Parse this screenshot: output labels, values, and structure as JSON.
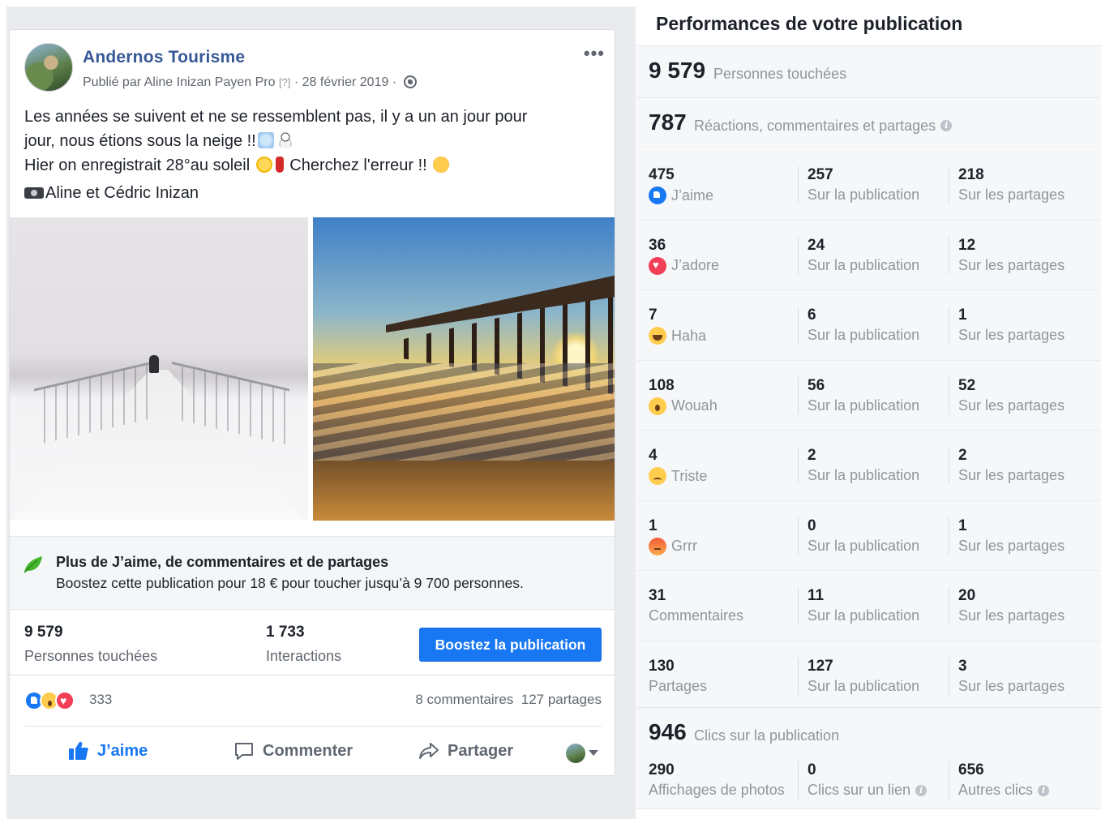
{
  "post": {
    "page_name": "Andernos Tourisme",
    "published_by": "Publié par Aline Inizan Payen Pro",
    "help_marker": "[?]",
    "date": "· 28 février 2019 ·",
    "more_label": "•••",
    "text_line1": "Les années se suivent et ne se ressemblent pas, il y a un an jour pour",
    "text_line2": "jour, nous étions sous la neige !!",
    "text_line3a": "Hier on enregistrait 28°au soleil",
    "text_line3b": "Cherchez l'erreur !!",
    "credit": "Aline et Cédric Inizan"
  },
  "promo": {
    "title": "Plus de J’aime, de commentaires et de partages",
    "subtitle": "Boostez cette publication pour 18 € pour toucher jusqu’à 9 700 personnes."
  },
  "stats": {
    "reach_num": "9 579",
    "reach_label": "Personnes touchées",
    "interactions_num": "1 733",
    "interactions_label": "Interactions",
    "boost_button": "Boostez la publication"
  },
  "reactions_bar": {
    "count": "333",
    "comments": "8 commentaires",
    "shares": "127 partages"
  },
  "actions": {
    "like": "J’aime",
    "comment": "Commenter",
    "share": "Partager"
  },
  "perf": {
    "title": "Performances de votre publication",
    "reach_num": "9 579",
    "reach_label": "Personnes touchées",
    "engagement_num": "787",
    "engagement_label": "Réactions, commentaires et partages",
    "rows": [
      {
        "total": "475",
        "label": "J’aime",
        "icon": "like-reaction-icon",
        "post": "257",
        "post_label": "Sur la publication",
        "shares": "218",
        "shares_label": "Sur les partages"
      },
      {
        "total": "36",
        "label": "J’adore",
        "icon": "love-reaction-icon",
        "post": "24",
        "post_label": "Sur la publication",
        "shares": "12",
        "shares_label": "Sur les partages"
      },
      {
        "total": "7",
        "label": "Haha",
        "icon": "haha-reaction-icon",
        "post": "6",
        "post_label": "Sur la publication",
        "shares": "1",
        "shares_label": "Sur les partages"
      },
      {
        "total": "108",
        "label": "Wouah",
        "icon": "wow-reaction-icon",
        "post": "56",
        "post_label": "Sur la publication",
        "shares": "52",
        "shares_label": "Sur les partages"
      },
      {
        "total": "4",
        "label": "Triste",
        "icon": "sad-reaction-icon",
        "post": "2",
        "post_label": "Sur la publication",
        "shares": "2",
        "shares_label": "Sur les partages"
      },
      {
        "total": "1",
        "label": "Grrr",
        "icon": "angry-reaction-icon",
        "post": "0",
        "post_label": "Sur la publication",
        "shares": "1",
        "shares_label": "Sur les partages"
      },
      {
        "total": "31",
        "label": "Commentaires",
        "icon": "",
        "post": "11",
        "post_label": "Sur la publication",
        "shares": "20",
        "shares_label": "Sur les partages"
      },
      {
        "total": "130",
        "label": "Partages",
        "icon": "",
        "post": "127",
        "post_label": "Sur la publication",
        "shares": "3",
        "shares_label": "Sur les partages"
      }
    ],
    "clicks_num": "946",
    "clicks_label": "Clics sur la publication",
    "clicks": [
      {
        "num": "290",
        "label": "Affichages de photos"
      },
      {
        "num": "0",
        "label": "Clics sur un lien"
      },
      {
        "num": "656",
        "label": "Autres clics"
      }
    ]
  },
  "colors": {
    "brand_blue": "#1877f2",
    "link_blue": "#385898",
    "muted_text": "#90949c"
  }
}
